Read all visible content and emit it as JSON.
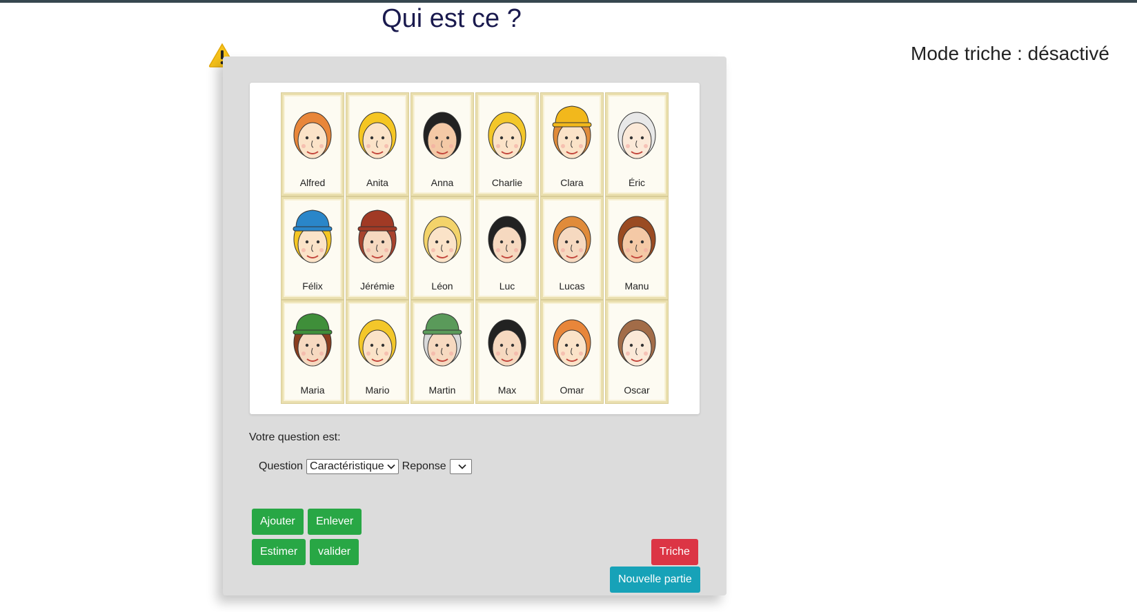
{
  "page": {
    "title": "Qui est ce ?",
    "mode_status": "Mode triche : désactivé"
  },
  "board": {
    "characters": [
      {
        "name": "Alfred",
        "hair": "#e8863a",
        "hat": null,
        "skin": "#fbe3c8"
      },
      {
        "name": "Anita",
        "hair": "#f5c623",
        "hat": null,
        "skin": "#fbe3c8"
      },
      {
        "name": "Anna",
        "hair": "#222222",
        "hat": null,
        "skin": "#f4c9a6"
      },
      {
        "name": "Charlie",
        "hair": "#f3c72a",
        "hat": null,
        "skin": "#fbe3c8"
      },
      {
        "name": "Clara",
        "hair": "#e08b3a",
        "hat": "#f2b81c",
        "skin": "#fbe3c8"
      },
      {
        "name": "Éric",
        "hair": "#e8e8e8",
        "hat": null,
        "skin": "#fbe9d8"
      },
      {
        "name": "Félix",
        "hair": "#f5c623",
        "hat": "#2a86c9",
        "skin": "#fbe3c8"
      },
      {
        "name": "Jérémie",
        "hair": "#a8432d",
        "hat": "#a13a25",
        "skin": "#f6d9c0"
      },
      {
        "name": "Léon",
        "hair": "#f3d36a",
        "hat": null,
        "skin": "#fbe3c8"
      },
      {
        "name": "Luc",
        "hair": "#222222",
        "hat": null,
        "skin": "#f6d9c0"
      },
      {
        "name": "Lucas",
        "hair": "#e08b3a",
        "hat": null,
        "skin": "#f6d9c0"
      },
      {
        "name": "Manu",
        "hair": "#9a4b22",
        "hat": null,
        "skin": "#f4c9a6"
      },
      {
        "name": "Maria",
        "hair": "#8a3e1f",
        "hat": "#3f8f3a",
        "skin": "#f6d9c0"
      },
      {
        "name": "Mario",
        "hair": "#f3c72a",
        "hat": null,
        "skin": "#fbe3c8"
      },
      {
        "name": "Martin",
        "hair": "#d9d9d9",
        "hat": "#5a9a5a",
        "skin": "#f6d9c0"
      },
      {
        "name": "Max",
        "hair": "#222222",
        "hat": null,
        "skin": "#f6d9c0"
      },
      {
        "name": "Omar",
        "hair": "#e8863a",
        "hat": null,
        "skin": "#fbe3c8"
      },
      {
        "name": "Oscar",
        "hair": "#a26c48",
        "hat": null,
        "skin": "#fbe9d8"
      }
    ]
  },
  "form": {
    "prompt": "Votre question est:",
    "question_label": "Question",
    "question_value": "Caractéristique",
    "reponse_label": "Reponse",
    "reponse_value": ""
  },
  "buttons": {
    "ajouter": "Ajouter",
    "enlever": "Enlever",
    "estimer": "Estimer",
    "valider": "valider",
    "triche": "Triche",
    "nouvelle_partie": "Nouvelle partie"
  },
  "colors": {
    "green": "#28a745",
    "red": "#dc3545",
    "teal": "#17a2b8",
    "panel": "#dcdcdc",
    "warning": "#f6c21b"
  }
}
